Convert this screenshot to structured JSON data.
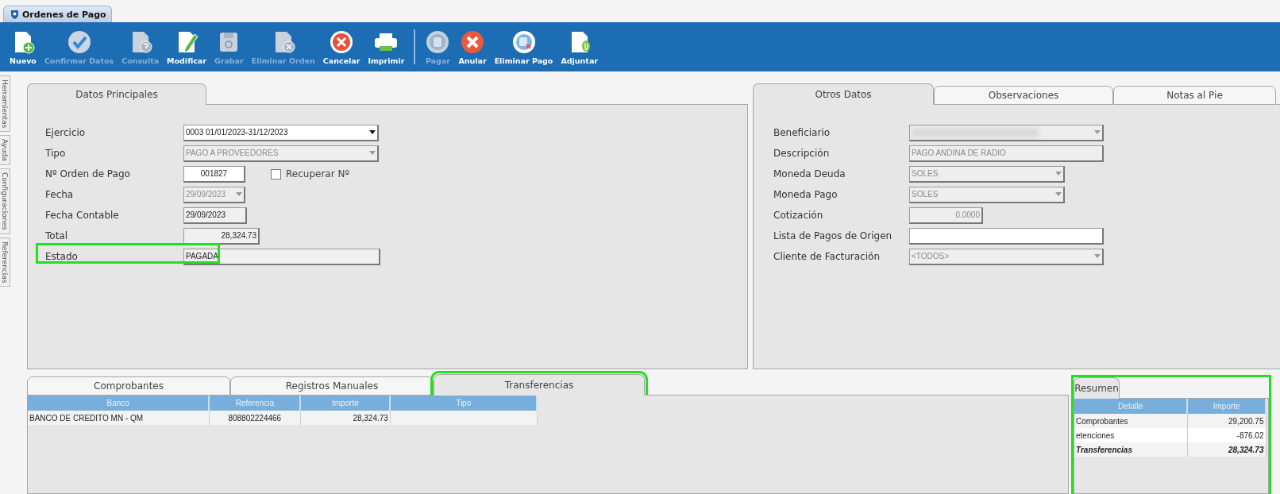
{
  "document_tab": {
    "title": "Ordenes de Pago",
    "selected": true
  },
  "toolbar": [
    {
      "label": "Nuevo",
      "kind": "new",
      "disabled": false,
      "separator_before": false
    },
    {
      "label": "Confirmar Datos",
      "kind": "confirm",
      "disabled": true,
      "separator_before": false
    },
    {
      "label": "Consulta",
      "kind": "query",
      "disabled": true,
      "separator_before": false
    },
    {
      "label": "Modificar",
      "kind": "edit",
      "disabled": false,
      "separator_before": false
    },
    {
      "label": "Grabar",
      "kind": "save",
      "disabled": true,
      "separator_before": false
    },
    {
      "label": "Eliminar Orden",
      "kind": "delete-doc",
      "disabled": true,
      "separator_before": false
    },
    {
      "label": "Cancelar",
      "kind": "cancel",
      "disabled": false,
      "separator_before": false
    },
    {
      "label": "Imprimir",
      "kind": "print",
      "disabled": false,
      "separator_before": false
    },
    {
      "label": "Pagar",
      "kind": "pay",
      "disabled": true,
      "separator_before": true
    },
    {
      "label": "Anular",
      "kind": "void",
      "disabled": false,
      "separator_before": false
    },
    {
      "label": "Eliminar Pago",
      "kind": "delete-pay",
      "disabled": false,
      "separator_before": false
    },
    {
      "label": "Adjuntar",
      "kind": "attach",
      "disabled": false,
      "separator_before": false
    }
  ],
  "side_tabs": [
    "Herramientas",
    "Ayuda",
    "Configuraciones",
    "Referencias"
  ],
  "main_panel": {
    "tabs": [
      {
        "label": "Datos Principales",
        "selected": true
      }
    ],
    "fields": [
      {
        "label": "Ejercicio",
        "kind": "combo",
        "value": "0003 01/01/2023-31/12/2023",
        "disabled": false,
        "highlighted": false
      },
      {
        "label": "Tipo",
        "kind": "combo",
        "value": "PAGO A PROVEEDORES",
        "disabled": true,
        "highlighted": false
      },
      {
        "label": "Nº Orden de Pago",
        "kind": "text",
        "value": "001827",
        "disabled": false,
        "highlighted": false,
        "checkbox": {
          "label": "Recuperar Nº",
          "checked": false
        }
      },
      {
        "label": "Fecha",
        "kind": "combo",
        "value": "29/09/2023",
        "disabled": true,
        "highlighted": false
      },
      {
        "label": "Fecha Contable",
        "kind": "display",
        "value": "29/09/2023",
        "disabled": false,
        "highlighted": false
      },
      {
        "label": "Total",
        "kind": "display",
        "value": "28,324.73",
        "disabled": false,
        "highlighted": false
      },
      {
        "label": "Estado",
        "kind": "display",
        "value": "PAGADA",
        "disabled": false,
        "highlighted": true
      }
    ]
  },
  "other_panel": {
    "tabs": [
      {
        "label": "Otros Datos",
        "selected": true
      },
      {
        "label": "Observaciones",
        "selected": false
      },
      {
        "label": "Notas al Pie",
        "selected": false
      }
    ],
    "fields": [
      {
        "label": "Beneficiario",
        "kind": "combo",
        "redacted": true,
        "disabled": true
      },
      {
        "label": "Descripción",
        "kind": "text",
        "value": "PAGO ANDINA DE RADIO",
        "disabled": true
      },
      {
        "label": "Moneda Deuda",
        "kind": "combo",
        "value": "SOLES",
        "disabled": true
      },
      {
        "label": "Moneda Pago",
        "kind": "combo",
        "value": "SOLES",
        "disabled": true
      },
      {
        "label": "Cotización",
        "kind": "text",
        "value": "0.0000",
        "disabled": true
      },
      {
        "label": "Lista de Pagos de Origen",
        "kind": "text",
        "disabled": false
      },
      {
        "label": "Cliente de Facturación",
        "kind": "combo",
        "value": "<TODOS>",
        "disabled": true
      }
    ]
  },
  "detail_panel": {
    "tabs": [
      {
        "label": "Comprobantes",
        "selected": false,
        "highlighted": false
      },
      {
        "label": "Registros Manuales",
        "selected": false,
        "highlighted": false
      },
      {
        "label": "Transferencias",
        "selected": true,
        "highlighted": true
      }
    ],
    "table": {
      "columns": [
        "Banco",
        "Referencia",
        "Importe",
        "Tipo"
      ],
      "rows": [
        {
          "cells": [
            "BANCO DE CREDITO MN - QM",
            "808802224466",
            "28,324.73"
          ]
        }
      ]
    }
  },
  "summary_panel": {
    "tabs": [
      {
        "label": "Resumen",
        "selected": true
      }
    ],
    "highlighted": true,
    "table": {
      "columns": [
        "Detalle",
        "Importe"
      ],
      "rows": [
        {
          "cells": [
            "Comprobantes",
            "29,200.75"
          ],
          "emphasis": false
        },
        {
          "cells": [
            "etenciones",
            "-876.02"
          ],
          "emphasis": false
        },
        {
          "cells": [
            "Transferencias",
            "28,324.73"
          ],
          "emphasis": true
        }
      ]
    }
  }
}
